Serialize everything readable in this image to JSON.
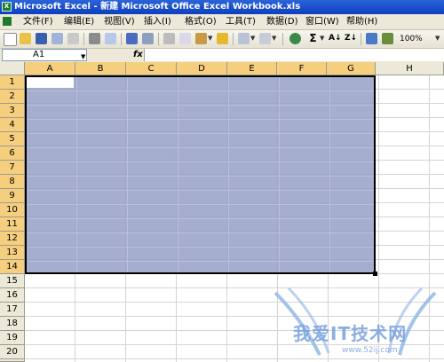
{
  "window": {
    "title": "Microsoft Excel - 新建 Microsoft Office Excel Workbook.xls"
  },
  "menu": [
    "文件(F)",
    "编辑(E)",
    "视图(V)",
    "插入(I)",
    "格式(O)",
    "工具(T)",
    "数据(D)",
    "窗口(W)",
    "帮助(H)"
  ],
  "toolbar": {
    "buttons": [
      "new-icon",
      "open-icon",
      "save-icon",
      "permission-icon",
      "email-icon",
      "print-icon",
      "print-preview-icon",
      "spelling-icon",
      "research-icon",
      "cut-icon",
      "copy-icon",
      "paste-icon",
      "format-painter-icon",
      "undo-icon",
      "redo-icon",
      "hyperlink-icon",
      "autosum-icon",
      "sort-ascending-icon",
      "sort-descending-icon",
      "chart-icon",
      "drawing-icon"
    ],
    "zoom": "100%"
  },
  "formula_bar": {
    "name_box": "A1",
    "fx_label": "fx",
    "content": ""
  },
  "sheet": {
    "columns": [
      "A",
      "B",
      "C",
      "D",
      "E",
      "F",
      "G",
      "H"
    ],
    "rows": [
      "1",
      "2",
      "3",
      "4",
      "5",
      "6",
      "7",
      "8",
      "9",
      "10",
      "11",
      "12",
      "13",
      "14",
      "15",
      "16",
      "17",
      "18",
      "19",
      "20",
      "21",
      "22"
    ],
    "selection": "A1:G14",
    "active_cell": "A1"
  },
  "watermark": {
    "text": "我爱IT技术网",
    "url": "www.52ij.com"
  },
  "colors": {
    "title_bar": "#0d3fbf",
    "selection": "#9aa3c8",
    "chrome": "#ece9d8"
  }
}
